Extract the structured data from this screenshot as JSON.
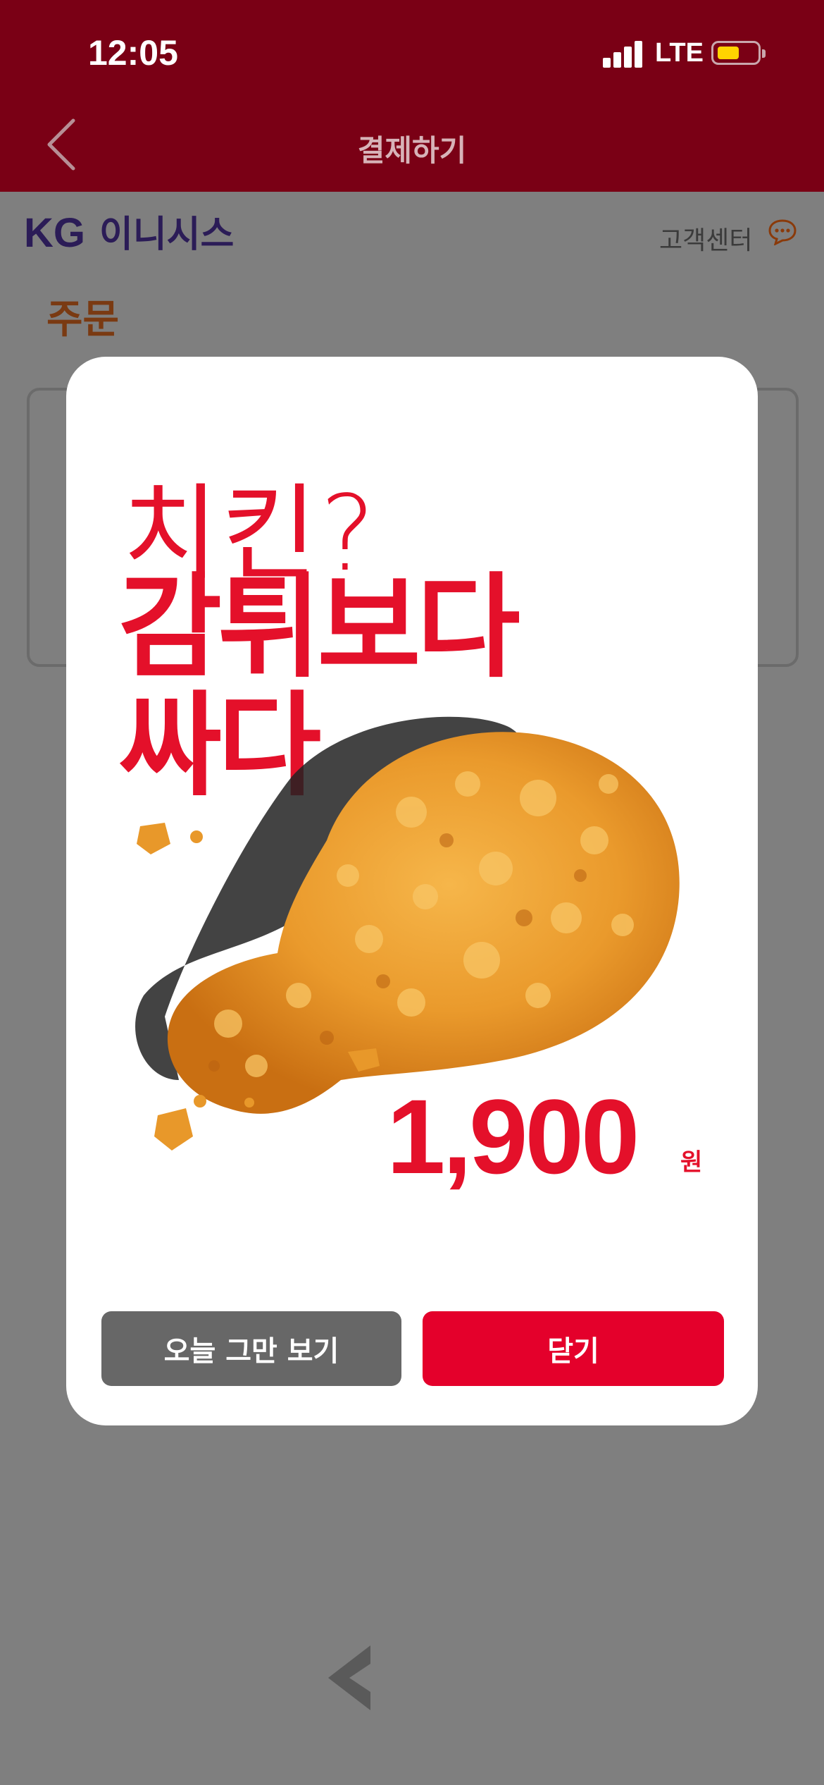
{
  "status_bar": {
    "time": "12:05",
    "network": "LTE",
    "battery_icon": "battery-icon",
    "signal_icon": "signal-icon"
  },
  "nav": {
    "title": "결제하기",
    "back_icon": "chevron-left-icon"
  },
  "page": {
    "logo_en": "KG",
    "logo_kr": "이니시스",
    "customer_center": "고객센터",
    "customer_center_icon": "chat-bubble-icon",
    "order_title": "주문"
  },
  "modal": {
    "ad_question": "치킨?",
    "ad_headline_1": "감튀보다",
    "ad_headline_2": "싸다",
    "price": "1,900",
    "price_unit": "원",
    "image": "fried-chicken-drumstick",
    "btn_hide_today": "오늘 그만 보기",
    "btn_close": "닫기"
  },
  "colors": {
    "header_bg": "#7a0015",
    "accent_red": "#e4002b",
    "dim_overlay": "#7f7f7f",
    "secondary_btn": "#676767"
  }
}
